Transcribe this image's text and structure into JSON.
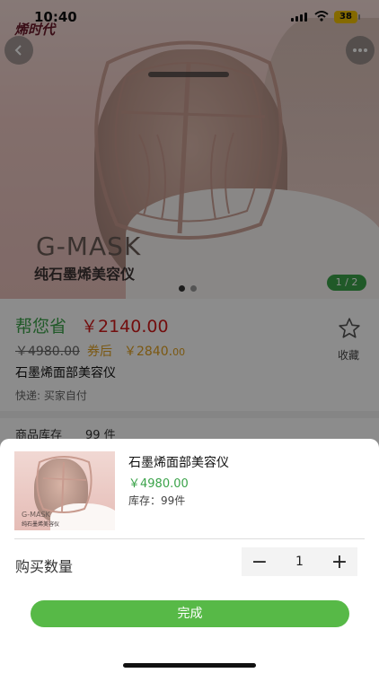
{
  "status_bar": {
    "time": "10:40",
    "battery": "38"
  },
  "hero": {
    "logo": "烯时代",
    "brand": "G-MASK",
    "brand_sub": "纯石墨烯美容仪",
    "pager": "1 / 2",
    "slide_count": 2,
    "active_slide": 1
  },
  "product": {
    "save_label": "帮您省",
    "save_amount": "￥2140.00",
    "original_price": "￥4980.00",
    "coupon_label": "券后",
    "coupon_price_main": "￥2840.",
    "coupon_price_cents": "00",
    "title": "石墨烯面部美容仪",
    "shipping": "快递: 买家自付",
    "favorite_label": "收藏"
  },
  "stock_row": {
    "label": "商品库存",
    "value": "99 件"
  },
  "sheet": {
    "title": "石墨烯面部美容仪",
    "price": "￥4980.00",
    "stock": "库存：99件",
    "qty_label": "购买数量",
    "qty_value": "1",
    "minus": "−",
    "plus": "+",
    "done_label": "完成",
    "thumb_brand": "G-MASK",
    "thumb_sub": "纯石墨烯美容仪"
  },
  "colors": {
    "accent_green": "#3ba34a",
    "price_red": "#d11a1a",
    "coupon_gold": "#e0a020",
    "button_green": "#57b947"
  },
  "icons": [
    "back-arrow-icon",
    "more-dots-icon",
    "star-icon",
    "signal-icon",
    "wifi-icon",
    "battery-icon"
  ]
}
